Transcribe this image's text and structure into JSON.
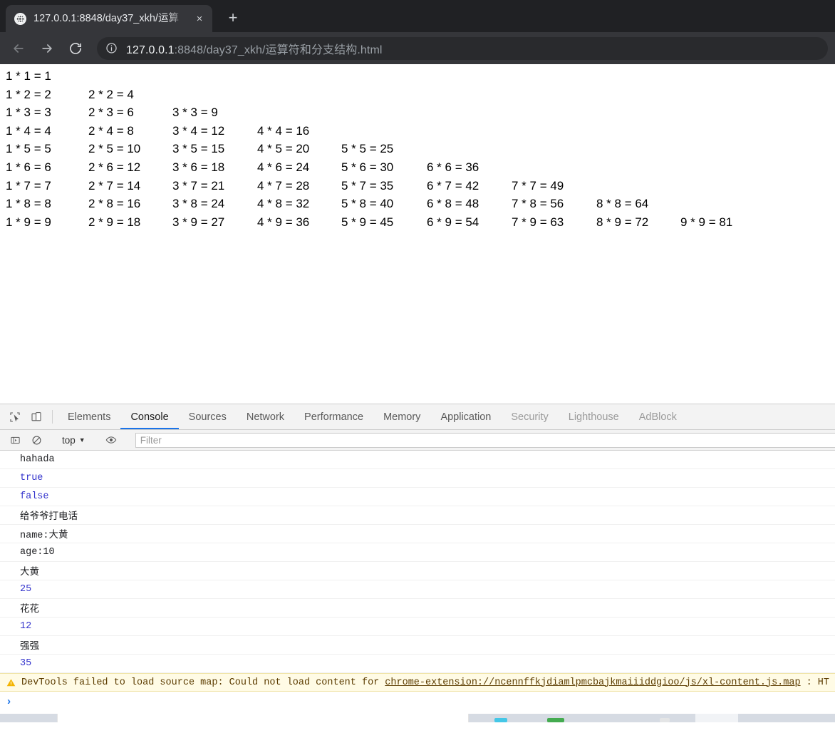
{
  "browser": {
    "tab": {
      "title": "127.0.0.1:8848/day37_xkh/运算",
      "favicon_icon": "globe-icon",
      "close_icon": "×"
    },
    "new_tab_icon": "+",
    "nav": {
      "back_icon": "←",
      "forward_icon": "→",
      "reload_icon": "⟳"
    },
    "omnibox": {
      "info_icon": "site-info-icon",
      "host": "127.0.0.1",
      "path": ":8848/day37_xkh/运算符和分支结构.html"
    }
  },
  "page": {
    "multiplication_table": [
      [
        "1 * 1 = 1"
      ],
      [
        "1 * 2 = 2",
        "2 * 2 = 4"
      ],
      [
        "1 * 3 = 3",
        "2 * 3 = 6",
        "3 * 3 = 9"
      ],
      [
        "1 * 4 = 4",
        "2 * 4 = 8",
        "3 * 4 = 12",
        "4 * 4 = 16"
      ],
      [
        "1 * 5 = 5",
        "2 * 5 = 10",
        "3 * 5 = 15",
        "4 * 5 = 20",
        "5 * 5 = 25"
      ],
      [
        "1 * 6 = 6",
        "2 * 6 = 12",
        "3 * 6 = 18",
        "4 * 6 = 24",
        "5 * 6 = 30",
        "6 * 6 = 36"
      ],
      [
        "1 * 7 = 7",
        "2 * 7 = 14",
        "3 * 7 = 21",
        "4 * 7 = 28",
        "5 * 7 = 35",
        "6 * 7 = 42",
        "7 * 7 = 49"
      ],
      [
        "1 * 8 = 8",
        "2 * 8 = 16",
        "3 * 8 = 24",
        "4 * 8 = 32",
        "5 * 8 = 40",
        "6 * 8 = 48",
        "7 * 8 = 56",
        "8 * 8 = 64"
      ],
      [
        "1 * 9 = 9",
        "2 * 9 = 18",
        "3 * 9 = 27",
        "4 * 9 = 36",
        "5 * 9 = 45",
        "6 * 9 = 54",
        "7 * 9 = 63",
        "8 * 9 = 72",
        "9 * 9 = 81"
      ]
    ]
  },
  "devtools": {
    "inspect_icon": "inspect-element-icon",
    "device_icon": "device-toolbar-icon",
    "tabs": [
      {
        "label": "Elements",
        "active": false,
        "dim": false
      },
      {
        "label": "Console",
        "active": true,
        "dim": false
      },
      {
        "label": "Sources",
        "active": false,
        "dim": false
      },
      {
        "label": "Network",
        "active": false,
        "dim": false
      },
      {
        "label": "Performance",
        "active": false,
        "dim": false
      },
      {
        "label": "Memory",
        "active": false,
        "dim": false
      },
      {
        "label": "Application",
        "active": false,
        "dim": false
      },
      {
        "label": "Security",
        "active": false,
        "dim": true
      },
      {
        "label": "Lighthouse",
        "active": false,
        "dim": true
      },
      {
        "label": "AdBlock",
        "active": false,
        "dim": true
      }
    ],
    "console_toolbar": {
      "sidebar_icon": "console-sidebar-icon",
      "clear_icon": "clear-console-icon",
      "context": "top",
      "context_caret": "▼",
      "eye_icon": "live-expression-icon",
      "filter_placeholder": "Filter",
      "filter_value": ""
    },
    "console_messages": [
      {
        "text": "hahada",
        "kind": "string"
      },
      {
        "text": "true",
        "kind": "bool"
      },
      {
        "text": "false",
        "kind": "bool"
      },
      {
        "text": "给爷爷打电话",
        "kind": "string"
      },
      {
        "text": "name:大黄",
        "kind": "string"
      },
      {
        "text": "age:10",
        "kind": "string"
      },
      {
        "text": "大黄",
        "kind": "string"
      },
      {
        "text": "25",
        "kind": "num"
      },
      {
        "text": "花花",
        "kind": "string"
      },
      {
        "text": "12",
        "kind": "num"
      },
      {
        "text": "强强",
        "kind": "string"
      },
      {
        "text": "35",
        "kind": "num"
      }
    ],
    "warning": {
      "icon": "warning-triangle-icon",
      "prefix": "DevTools failed to load source map: Could not load content for",
      "link": "chrome-extension://ncennffkjdiamlpmcbajkmaiiiddgioo/js/xl-content.js.map",
      "suffix": ": HT"
    },
    "prompt_icon": "›"
  },
  "colors": {
    "accent": "#1a73e8",
    "chrome_dark": "#202124",
    "toolbar_dark": "#35363a",
    "console_blue": "#3333cc",
    "warn_bg": "#fffbe5"
  }
}
